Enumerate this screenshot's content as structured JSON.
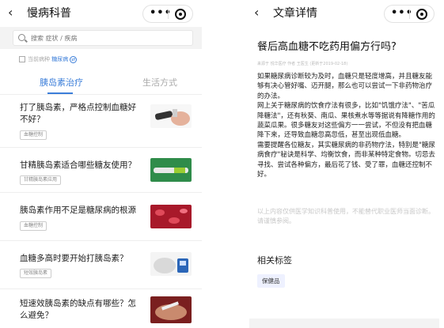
{
  "left": {
    "title": "慢病科普",
    "back_icon": "chevron-left-icon",
    "search": {
      "placeholder": "搜索 症状 / 疾病"
    },
    "disease": {
      "label": "当前病种",
      "value": "糖尿病"
    },
    "tabs": [
      {
        "label": "胰岛素治疗",
        "active": true
      },
      {
        "label": "生活方式",
        "active": false
      }
    ],
    "articles": [
      {
        "title": "打了胰岛素，严格点控制血糖好不好？",
        "tag": "血糖控制",
        "image": "injection-pen-image"
      },
      {
        "title": "甘精胰岛素适合哪些糖友使用？",
        "tag": "甘精胰岛素应用",
        "image": "insulin-pen-image"
      },
      {
        "title": "胰岛素作用不足是糖尿病的根源",
        "tag": "血糖控制",
        "image": "red-cells-image"
      },
      {
        "title": "血糖多高时要开始打胰岛素？",
        "tag": "短效胰岛素",
        "image": "glucose-meter-image"
      },
      {
        "title": "短速效胰岛素的缺点有哪些？怎么避免？",
        "tag": "",
        "image": "arm-injection-image"
      }
    ]
  },
  "right": {
    "title": "文章详情",
    "article_title": "餐后高血糖不吃药用偏方行吗?",
    "meta": "来源于 悦华医疗 作者 王医生 (更新于2019-02-18)",
    "paragraphs": [
      "如果糖尿病诊断较为及时，血糖只是轻度增高，并且糖友能够有决心管好嘴、迈开腿，那么也可以尝试一下非药物治疗的办法。",
      "网上关于糖尿病的饮食疗法有很多，比如\"饥饿疗法\"、\"苦瓜降糖法\"，还有秋葵、南瓜、果核煮水等等据说有降糖作用的蔬菜瓜果。很多糖友对这些偏方一一尝试，不但没有把血糖降下来，还导致血糖忽高忽低，甚至出现低血糖。",
      "需要提醒各位糖友，其实糖尿病的非药物疗法，特别是\"糖尿病食疗\"秘诀是科学、均衡饮食，而非某种特定食物。切忌去寻找、尝试各种偏方，最后花了钱、受了罪，血糖还控制不好。"
    ],
    "disclaimer": "以上内容仅供医学知识科普使用，不能替代职业医师当面诊断。请谨慎参阅。",
    "related_heading": "相关标签",
    "related_tag": "保健品"
  },
  "capsule": {
    "more_icon": "more-dots-icon",
    "close_icon": "target-circle-icon"
  },
  "colors": {
    "accent": "#3b7ed9",
    "tag_bg": "#eef1ff",
    "divider": "#eeeeee"
  }
}
